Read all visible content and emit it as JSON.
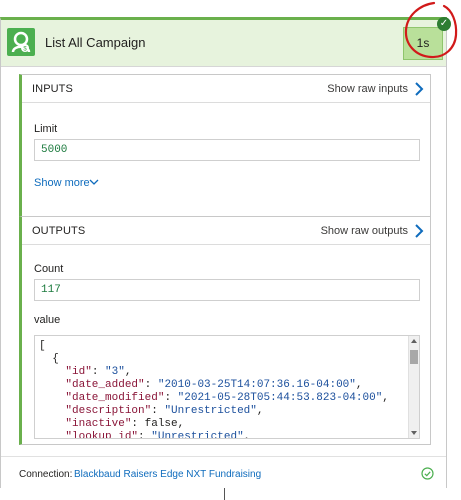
{
  "action": {
    "title": "List All Campaign",
    "duration": "1s",
    "icon": "blackbaud-logo-icon",
    "status_icon": "success-check-icon"
  },
  "inputs": {
    "section_title": "INPUTS",
    "raw_link": "Show raw inputs",
    "limit_label": "Limit",
    "limit_value": "5000",
    "show_more": "Show more"
  },
  "outputs": {
    "section_title": "OUTPUTS",
    "raw_link": "Show raw outputs",
    "count_label": "Count",
    "count_value": "117",
    "value_label": "value",
    "json_lines": [
      "[",
      "  {",
      "    \"id\": \"3\",",
      "    \"date_added\": \"2010-03-25T14:07:36.16-04:00\",",
      "    \"date_modified\": \"2021-05-28T05:44:53.823-04:00\",",
      "    \"description\": \"Unrestricted\",",
      "    \"inactive\": false,",
      "    \"lookup_id\": \"Unrestricted\","
    ]
  },
  "connection": {
    "label": "Connection:",
    "name": "Blackbaud Raisers Edge NXT Fundraising"
  },
  "colors": {
    "accent_green": "#6ab04c",
    "header_bg": "#e7f3dd",
    "link_blue": "#0f6cbd",
    "annotation_red": "#d11a1a"
  }
}
